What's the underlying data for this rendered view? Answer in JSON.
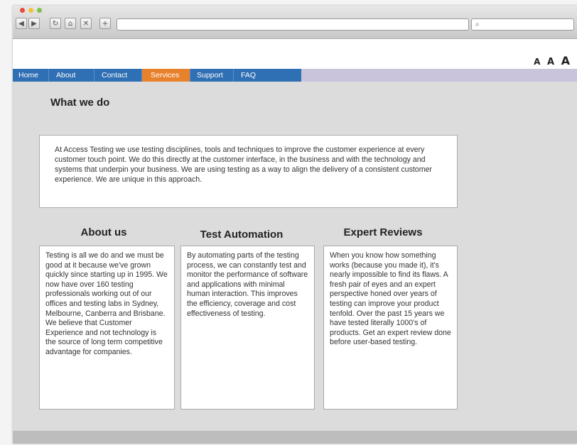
{
  "browser": {
    "nav_back": "◀",
    "nav_forward": "▶",
    "reload": "↻",
    "home": "⌂",
    "close": "✕",
    "new_tab": "+",
    "search_icon": "🔍"
  },
  "textsize": {
    "small": "A",
    "medium": "A",
    "large": "A"
  },
  "nav": {
    "items": [
      "Home",
      "About",
      "Contact",
      "Services",
      "Support",
      "FAQ"
    ],
    "active": "Services"
  },
  "colors": {
    "nav_bg": "#2f6fb3",
    "nav_active": "#e8812c",
    "nav_strip": "#c9c4dc"
  },
  "what_we_do": {
    "heading": "What we do",
    "text": "At Access Testing we use testing disciplines, tools and techniques to improve the customer experience at every customer touch point. We do this directly at the customer interface, in the business and with the technology and systems that underpin your business. We are using testing as a way to align the delivery of a consistent customer experience. We are unique in this approach."
  },
  "columns": [
    {
      "title": "About us",
      "text": "Testing is all we do and we must be good at it because we've grown quickly since starting up in 1995. We now have over 160 testing professionals working out of our offices and testing labs in Sydney, Melbourne, Canberra and Brisbane. We believe that Customer Experience and not technology is the source of long term competitive advantage for companies."
    },
    {
      "title": "Test Automation",
      "text": "By automating parts of the testing process, we can constantly test and monitor the performance of software and applications with minimal human interaction. This improves the efficiency, coverage and cost effectiveness of testing."
    },
    {
      "title": "Expert Reviews",
      "text": "When you know how something works (because you made it), it's nearly impossible to find its flaws. A fresh pair of eyes and an expert perspective honed over years of testing can improve your product tenfold. Over the past 15 years we have tested literally 1000's of products. Get an expert review done before user-based testing."
    }
  ]
}
